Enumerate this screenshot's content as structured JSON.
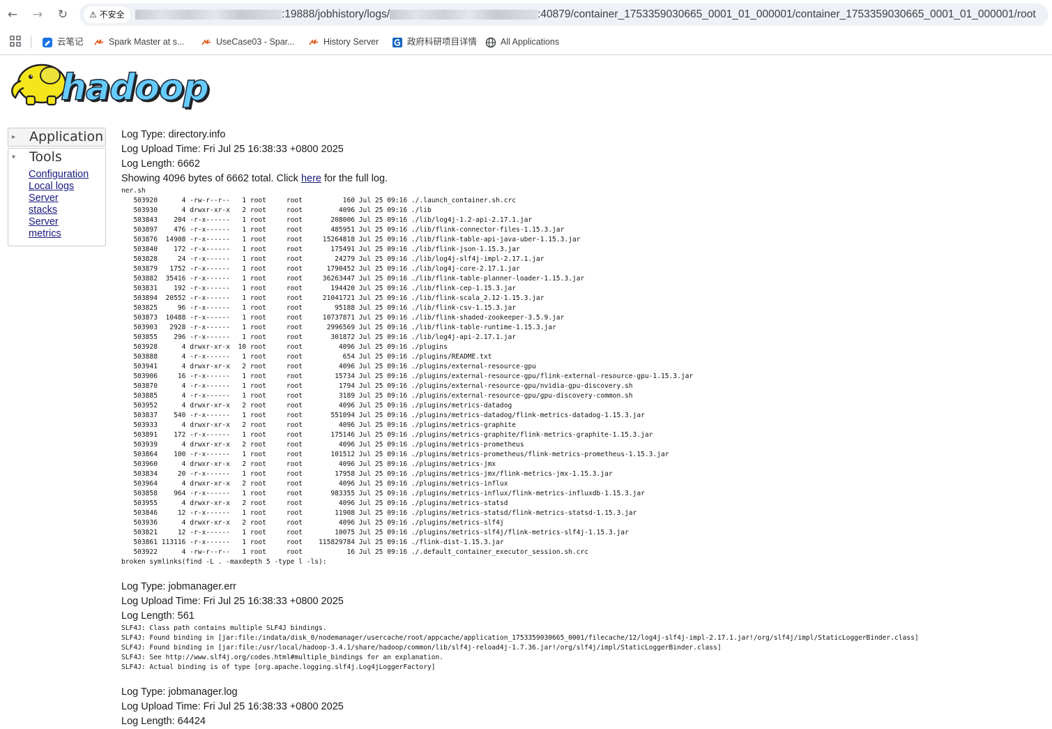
{
  "browser": {
    "security_label": "不安全",
    "url_parts": [
      ":19888/jobhistory/logs/",
      ":40879/container_1753359030665_0001_01_000001/container_1753359030665_0001_01_000001/root"
    ],
    "bookmarks": [
      {
        "label": "云笔记",
        "icon": "cloud-note-icon"
      },
      {
        "label": "Spark Master at s...",
        "icon": "spark-icon"
      },
      {
        "label": "UseCase03 - Spar...",
        "icon": "spark-icon"
      },
      {
        "label": "History Server",
        "icon": "spark-icon"
      },
      {
        "label": "政府科研项目详情",
        "icon": "gov-site-icon"
      },
      {
        "label": "All Applications",
        "icon": "globe-icon"
      }
    ]
  },
  "logo": {
    "text": "hadoop"
  },
  "sidebar": {
    "application_label": "Application",
    "tools_label": "Tools",
    "tools_links": [
      "Configuration",
      "Local logs",
      "Server stacks",
      "Server metrics"
    ]
  },
  "logs": [
    {
      "type_line": "Log Type: directory.info",
      "upload_line": "Log Upload Time: Fri Jul 25 16:38:33 +0800 2025",
      "length_line": "Log Length: 6662",
      "showing_prefix": "Showing 4096 bytes of 6662 total. Click ",
      "showing_link": "here",
      "showing_suffix": " for the full log.",
      "lines": [
        "ner.sh",
        "   503920      4 -rw-r--r--   1 root     root          160 Jul 25 09:16 ./.launch_container.sh.crc",
        "   503930      4 drwxr-xr-x   2 root     root         4096 Jul 25 09:16 ./lib",
        "   503843    204 -r-x------   1 root     root       208006 Jul 25 09:16 ./lib/log4j-1.2-api-2.17.1.jar",
        "   503897    476 -r-x------   1 root     root       485951 Jul 25 09:16 ./lib/flink-connector-files-1.15.3.jar",
        "   503876  14908 -r-x------   1 root     root     15264818 Jul 25 09:16 ./lib/flink-table-api-java-uber-1.15.3.jar",
        "   503840    172 -r-x------   1 root     root       175491 Jul 25 09:16 ./lib/flink-json-1.15.3.jar",
        "   503828     24 -r-x------   1 root     root        24279 Jul 25 09:16 ./lib/log4j-slf4j-impl-2.17.1.jar",
        "   503879   1752 -r-x------   1 root     root      1790452 Jul 25 09:16 ./lib/log4j-core-2.17.1.jar",
        "   503882  35416 -r-x------   1 root     root     36263447 Jul 25 09:16 ./lib/flink-table-planner-loader-1.15.3.jar",
        "   503831    192 -r-x------   1 root     root       194420 Jul 25 09:16 ./lib/flink-cep-1.15.3.jar",
        "   503894  20552 -r-x------   1 root     root     21041721 Jul 25 09:16 ./lib/flink-scala_2.12-1.15.3.jar",
        "   503825     96 -r-x------   1 root     root        95188 Jul 25 09:16 ./lib/flink-csv-1.15.3.jar",
        "   503873  10488 -r-x------   1 root     root     10737871 Jul 25 09:16 ./lib/flink-shaded-zookeeper-3.5.9.jar",
        "   503903   2928 -r-x------   1 root     root      2996569 Jul 25 09:16 ./lib/flink-table-runtime-1.15.3.jar",
        "   503855    296 -r-x------   1 root     root       301872 Jul 25 09:16 ./lib/log4j-api-2.17.1.jar",
        "   503928      4 drwxr-xr-x  10 root     root         4096 Jul 25 09:16 ./plugins",
        "   503888      4 -r-x------   1 root     root          654 Jul 25 09:16 ./plugins/README.txt",
        "   503941      4 drwxr-xr-x   2 root     root         4096 Jul 25 09:16 ./plugins/external-resource-gpu",
        "   503906     16 -r-x------   1 root     root        15734 Jul 25 09:16 ./plugins/external-resource-gpu/flink-external-resource-gpu-1.15.3.jar",
        "   503870      4 -r-x------   1 root     root         1794 Jul 25 09:16 ./plugins/external-resource-gpu/nvidia-gpu-discovery.sh",
        "   503885      4 -r-x------   1 root     root         3189 Jul 25 09:16 ./plugins/external-resource-gpu/gpu-discovery-common.sh",
        "   503952      4 drwxr-xr-x   2 root     root         4096 Jul 25 09:16 ./plugins/metrics-datadog",
        "   503837    540 -r-x------   1 root     root       551094 Jul 25 09:16 ./plugins/metrics-datadog/flink-metrics-datadog-1.15.3.jar",
        "   503933      4 drwxr-xr-x   2 root     root         4096 Jul 25 09:16 ./plugins/metrics-graphite",
        "   503891    172 -r-x------   1 root     root       175146 Jul 25 09:16 ./plugins/metrics-graphite/flink-metrics-graphite-1.15.3.jar",
        "   503939      4 drwxr-xr-x   2 root     root         4096 Jul 25 09:16 ./plugins/metrics-prometheus",
        "   503864    100 -r-x------   1 root     root       101512 Jul 25 09:16 ./plugins/metrics-prometheus/flink-metrics-prometheus-1.15.3.jar",
        "   503960      4 drwxr-xr-x   2 root     root         4096 Jul 25 09:16 ./plugins/metrics-jmx",
        "   503834     20 -r-x------   1 root     root        17958 Jul 25 09:16 ./plugins/metrics-jmx/flink-metrics-jmx-1.15.3.jar",
        "   503964      4 drwxr-xr-x   2 root     root         4096 Jul 25 09:16 ./plugins/metrics-influx",
        "   503858    964 -r-x------   1 root     root       983355 Jul 25 09:16 ./plugins/metrics-influx/flink-metrics-influxdb-1.15.3.jar",
        "   503955      4 drwxr-xr-x   2 root     root         4096 Jul 25 09:16 ./plugins/metrics-statsd",
        "   503846     12 -r-x------   1 root     root        11908 Jul 25 09:16 ./plugins/metrics-statsd/flink-metrics-statsd-1.15.3.jar",
        "   503936      4 drwxr-xr-x   2 root     root         4096 Jul 25 09:16 ./plugins/metrics-slf4j",
        "   503821     12 -r-x------   1 root     root        10075 Jul 25 09:16 ./plugins/metrics-slf4j/flink-metrics-slf4j-1.15.3.jar",
        "   503861 113116 -r-x------   1 root     root    115829784 Jul 25 09:16 ./flink-dist-1.15.3.jar",
        "   503922      4 -rw-r--r--   1 root     root           16 Jul 25 09:16 ./.default_container_executor_session.sh.crc",
        "broken symlinks(find -L . -maxdepth 5 -type l -ls):"
      ]
    },
    {
      "type_line": "Log Type: jobmanager.err",
      "upload_line": "Log Upload Time: Fri Jul 25 16:38:33 +0800 2025",
      "length_line": "Log Length: 561",
      "lines": [
        "SLF4J: Class path contains multiple SLF4J bindings.",
        "SLF4J: Found binding in [jar:file:/indata/disk_0/nodemanager/usercache/root/appcache/application_1753359030665_0001/filecache/12/log4j-slf4j-impl-2.17.1.jar!/org/slf4j/impl/StaticLoggerBinder.class]",
        "SLF4J: Found binding in [jar:file:/usr/local/hadoop-3.4.1/share/hadoop/common/lib/slf4j-reload4j-1.7.36.jar!/org/slf4j/impl/StaticLoggerBinder.class]",
        "SLF4J: See http://www.slf4j.org/codes.html#multiple_bindings for an explanation.",
        "SLF4J: Actual binding is of type [org.apache.logging.slf4j.Log4jLoggerFactory]"
      ]
    },
    {
      "type_line": "Log Type: jobmanager.log",
      "upload_line": "Log Upload Time: Fri Jul 25 16:38:33 +0800 2025",
      "length_line": "Log Length: 64424"
    }
  ]
}
